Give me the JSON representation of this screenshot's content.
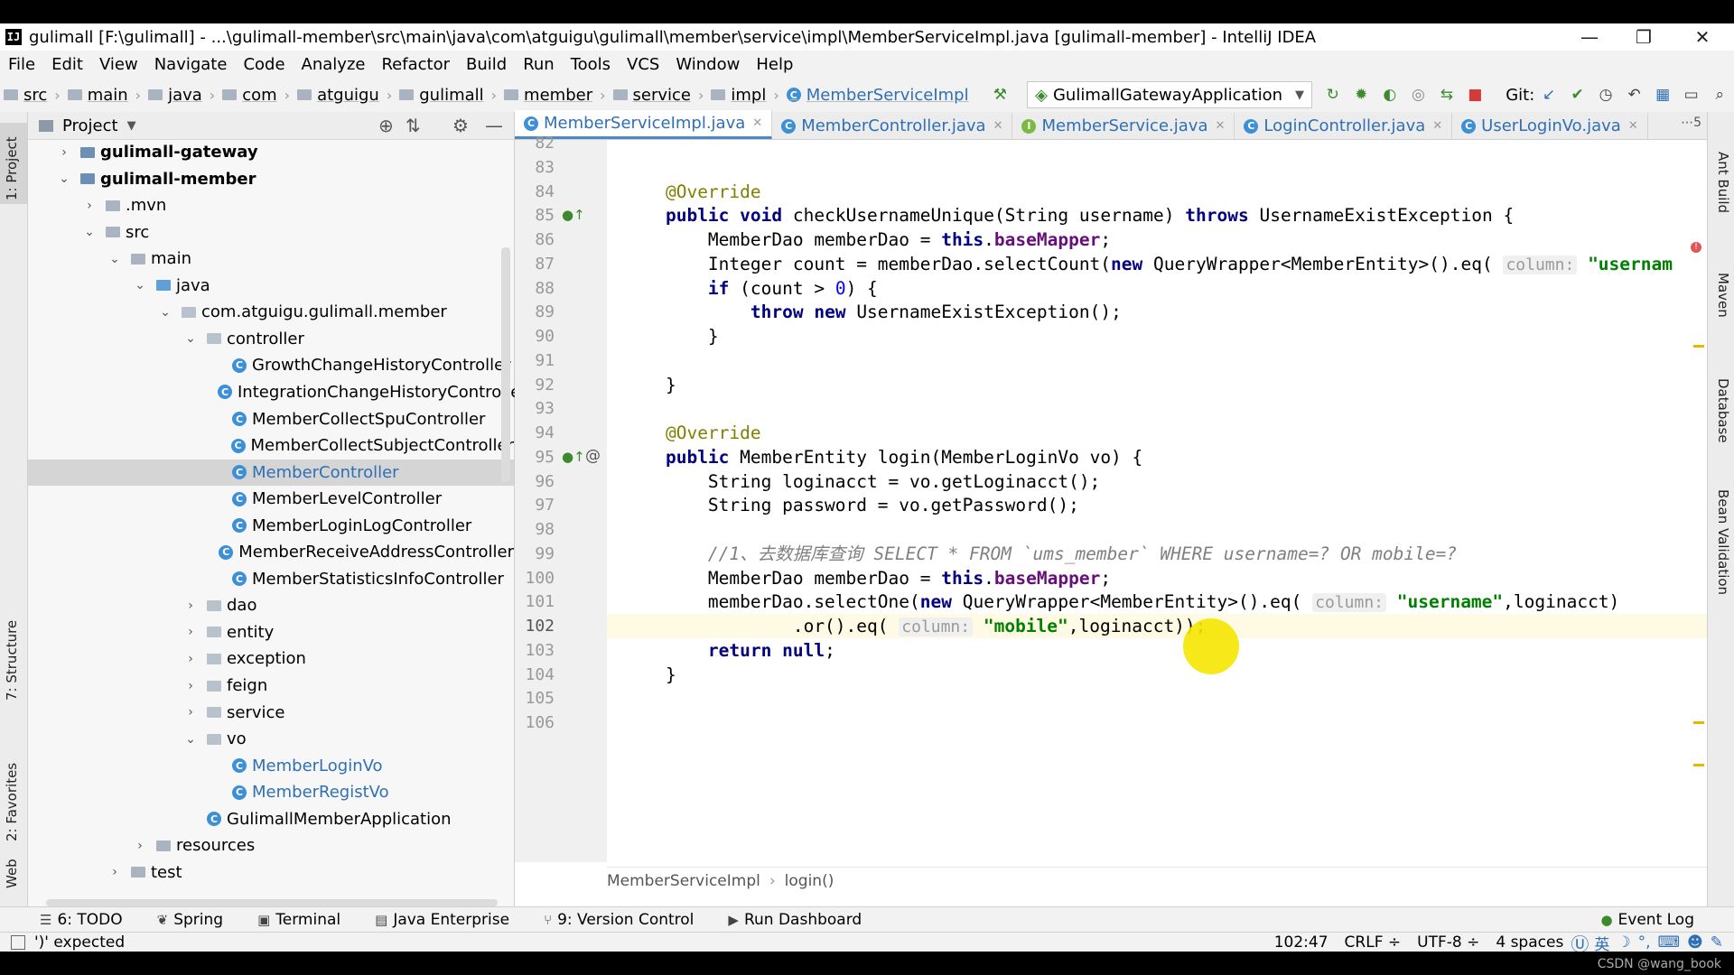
{
  "window": {
    "title": "gulimall [F:\\gulimall] - ...\\gulimall-member\\src\\main\\java\\com\\atguigu\\gulimall\\member\\service\\impl\\MemberServiceImpl.java [gulimall-member] - IntelliJ IDEA",
    "logo": "IJ",
    "minimize": "—",
    "restore": "❐",
    "close": "✕"
  },
  "menu": [
    "File",
    "Edit",
    "View",
    "Navigate",
    "Code",
    "Analyze",
    "Refactor",
    "Build",
    "Run",
    "Tools",
    "VCS",
    "Window",
    "Help"
  ],
  "nav": {
    "crumbs": [
      "src",
      "main",
      "java",
      "com",
      "atguigu",
      "gulimall",
      "member",
      "service",
      "impl"
    ],
    "class_crumb": "MemberServiceImpl",
    "run_config": "GulimallGatewayApplication",
    "git_label": "Git:"
  },
  "left_stripe": {
    "project": "1: Project",
    "structure": "7: Structure",
    "favorites": "2: Favorites",
    "web": "Web"
  },
  "project": {
    "header": "Project",
    "tree": [
      {
        "label": "gulimall-gateway",
        "arrow": "›",
        "type": "module"
      },
      {
        "label": "gulimall-member",
        "arrow": "⌄",
        "type": "module"
      },
      {
        "label": ".mvn",
        "arrow": "›",
        "type": "folder"
      },
      {
        "label": "src",
        "arrow": "⌄",
        "type": "folder"
      },
      {
        "label": "main",
        "arrow": "⌄",
        "type": "folder"
      },
      {
        "label": "java",
        "arrow": "⌄",
        "type": "srcfolder"
      },
      {
        "label": "com.atguigu.gulimall.member",
        "arrow": "⌄",
        "type": "package"
      },
      {
        "label": "controller",
        "arrow": "⌄",
        "type": "package"
      },
      {
        "label": "GrowthChangeHistoryController",
        "arrow": "",
        "type": "class"
      },
      {
        "label": "IntegrationChangeHistoryControlle",
        "arrow": "",
        "type": "class"
      },
      {
        "label": "MemberCollectSpuController",
        "arrow": "",
        "type": "class"
      },
      {
        "label": "MemberCollectSubjectController",
        "arrow": "",
        "type": "class"
      },
      {
        "label": "MemberController",
        "arrow": "",
        "type": "class"
      },
      {
        "label": "MemberLevelController",
        "arrow": "",
        "type": "class"
      },
      {
        "label": "MemberLoginLogController",
        "arrow": "",
        "type": "class"
      },
      {
        "label": "MemberReceiveAddressController",
        "arrow": "",
        "type": "class"
      },
      {
        "label": "MemberStatisticsInfoController",
        "arrow": "",
        "type": "class"
      },
      {
        "label": "dao",
        "arrow": "›",
        "type": "package"
      },
      {
        "label": "entity",
        "arrow": "›",
        "type": "package"
      },
      {
        "label": "exception",
        "arrow": "›",
        "type": "package"
      },
      {
        "label": "feign",
        "arrow": "›",
        "type": "package"
      },
      {
        "label": "service",
        "arrow": "›",
        "type": "package"
      },
      {
        "label": "vo",
        "arrow": "⌄",
        "type": "package"
      },
      {
        "label": "MemberLoginVo",
        "arrow": "",
        "type": "class"
      },
      {
        "label": "MemberRegistVo",
        "arrow": "",
        "type": "class"
      },
      {
        "label": "GulimallMemberApplication",
        "arrow": "",
        "type": "appclass"
      },
      {
        "label": "resources",
        "arrow": "›",
        "type": "folder"
      },
      {
        "label": "test",
        "arrow": "›",
        "type": "folder"
      }
    ]
  },
  "tabs": [
    {
      "label": "MemberServiceImpl.java",
      "icon": "C",
      "active": true
    },
    {
      "label": "MemberController.java",
      "icon": "C",
      "active": false
    },
    {
      "label": "MemberService.java",
      "icon": "I",
      "active": false
    },
    {
      "label": "LoginController.java",
      "icon": "C",
      "active": false
    },
    {
      "label": "UserLoginVo.java",
      "icon": "C",
      "active": false
    }
  ],
  "tab_menu": "⋯5",
  "code": {
    "line_numbers": [
      "82",
      "83",
      "84",
      "85",
      "86",
      "87",
      "88",
      "89",
      "90",
      "91",
      "92",
      "93",
      "94",
      "95",
      "96",
      "97",
      "98",
      "99",
      "100",
      "101",
      "102",
      "103",
      "104",
      "105",
      "106"
    ],
    "lines": [
      "",
      "",
      "    @Override",
      "    public void checkUsernameUnique(String username) throws UsernameExistException {",
      "        MemberDao memberDao = this.baseMapper;",
      "        Integer count = memberDao.selectCount(new QueryWrapper<MemberEntity>().eq( column: \"usernam",
      "        if (count > 0) {",
      "            throw new UsernameExistException();",
      "        }",
      "",
      "    }",
      "",
      "    @Override",
      "    public MemberEntity login(MemberLoginVo vo) {",
      "        String loginacct = vo.getLoginacct();",
      "        String password = vo.getPassword();",
      "",
      "        //1、去数据库查询 SELECT * FROM `ums_member` WHERE username=? OR mobile=?",
      "        MemberDao memberDao = this.baseMapper;",
      "        memberDao.selectOne(new QueryWrapper<MemberEntity>().eq( column: \"username\",loginacct)",
      "                .or().eq( column: \"mobile\",loginacct));",
      "        return null;",
      "    }",
      "",
      ""
    ]
  },
  "code_breadcrumb": [
    "MemberServiceImpl",
    "login()"
  ],
  "right_stripe": [
    "Ant Build",
    "Maven",
    "Database",
    "Bean Validation"
  ],
  "toolwindows": [
    {
      "label": "6: TODO",
      "icon": "☰"
    },
    {
      "label": "Spring",
      "icon": "❦"
    },
    {
      "label": "Terminal",
      "icon": "▣"
    },
    {
      "label": "Java Enterprise",
      "icon": "▤"
    },
    {
      "label": "9: Version Control",
      "icon": "⑂"
    },
    {
      "label": "Run Dashboard",
      "icon": "▶"
    }
  ],
  "event_log": "Event Log",
  "status": {
    "message": "')' expected",
    "position": "102:47",
    "line_sep": "CRLF ÷",
    "encoding": "UTF-8 ÷",
    "indent": "4 spaces",
    "ime": "英"
  },
  "watermark": "CSDN @wang_book"
}
